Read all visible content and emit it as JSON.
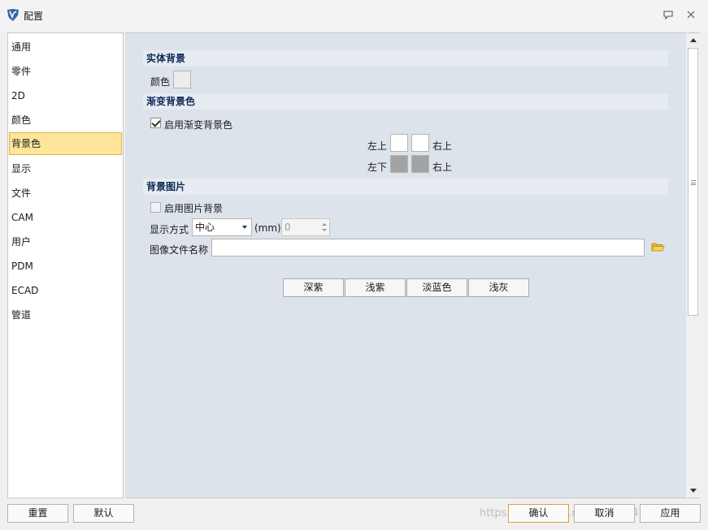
{
  "window": {
    "title": "配置"
  },
  "sidebar": {
    "items": [
      {
        "label": "通用"
      },
      {
        "label": "零件"
      },
      {
        "label": "2D"
      },
      {
        "label": "颜色"
      },
      {
        "label": "背景色"
      },
      {
        "label": "显示"
      },
      {
        "label": "文件"
      },
      {
        "label": "CAM"
      },
      {
        "label": "用户"
      },
      {
        "label": "PDM"
      },
      {
        "label": "ECAD"
      },
      {
        "label": "管道"
      }
    ],
    "active_index": 4
  },
  "solid_bg": {
    "header": "实体背景",
    "color_label": "颜色",
    "color": "#ececec"
  },
  "gradient": {
    "header": "渐变背景色",
    "enable_label": "启用渐变背景色",
    "enabled": true,
    "top_left_label": "左上",
    "top_right_label": "右上",
    "bottom_left_label": "左下",
    "bottom_right_label": "右上",
    "top_left_color": "#ffffff",
    "top_right_color": "#ffffff",
    "bottom_left_color": "#a3a3a3",
    "bottom_right_color": "#a3a3a3"
  },
  "bg_image": {
    "header": "背景图片",
    "enable_label": "启用图片背景",
    "enabled": false,
    "mode_label": "显示方式",
    "mode_value": "中心",
    "unit_label": "(mm)",
    "size_value": "0",
    "file_label": "图像文件名称",
    "file_value": ""
  },
  "presets": [
    {
      "label": "深紫"
    },
    {
      "label": "浅紫"
    },
    {
      "label": "淡蓝色"
    },
    {
      "label": "浅灰"
    }
  ],
  "footer": {
    "reset_label": "重置",
    "default_label": "默认",
    "ok_label": "确认",
    "cancel_label": "取消",
    "apply_label": "应用",
    "watermark": "https://blog.csdn.net/weixin_43709798"
  },
  "colors": {
    "accent_border": "#e0a040",
    "active_bg": "#fde69a",
    "section_text": "#102a57",
    "content_bg": "#dde3ea"
  }
}
